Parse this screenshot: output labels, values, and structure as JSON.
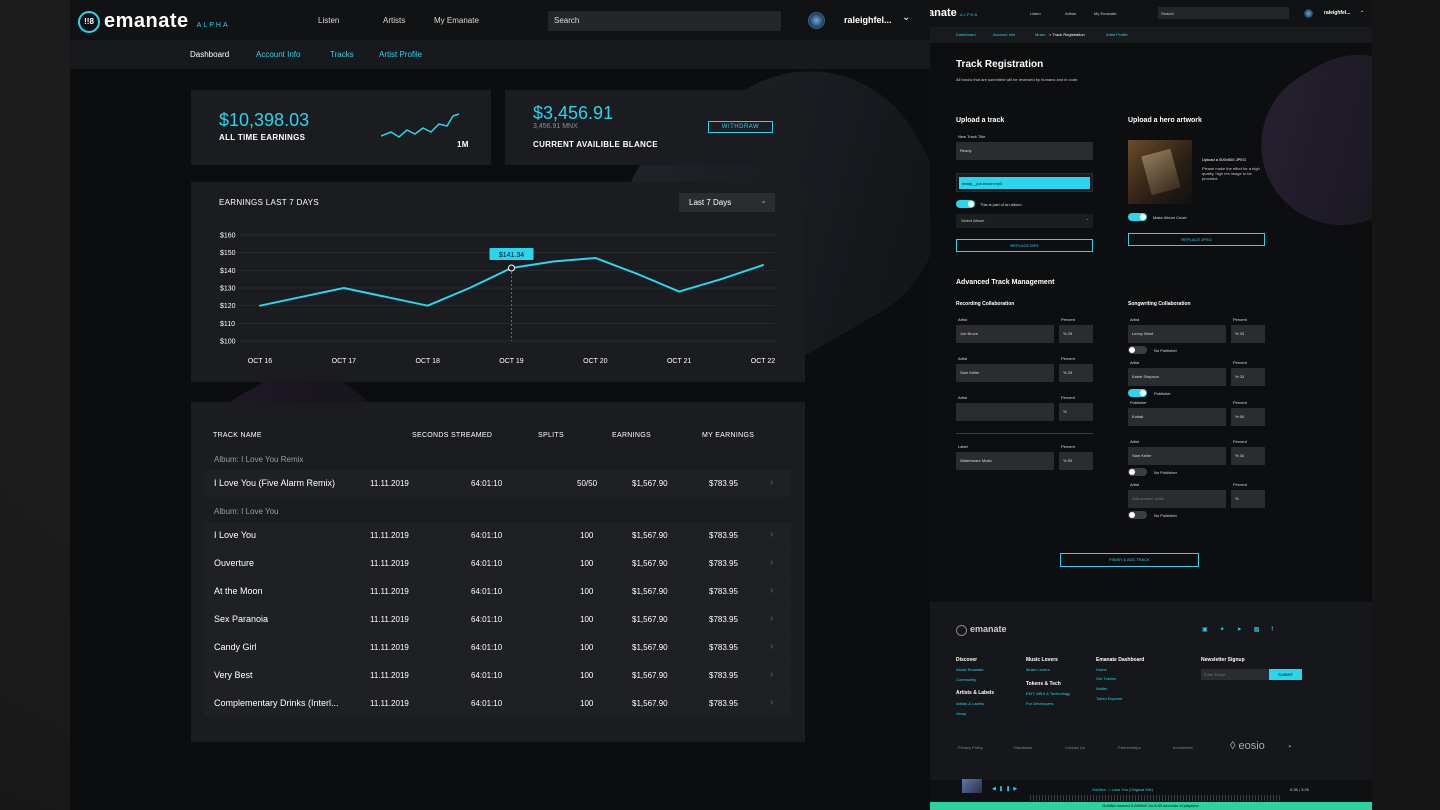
{
  "colors": {
    "accent": "#29d5ef",
    "background": "#0c0d0f",
    "card": "#1b1c1f",
    "row": "#1f2024",
    "notice_bar": "#2bd49e"
  },
  "brand": {
    "badge": "!!8",
    "name": "emanate",
    "tag": "ALPHA"
  },
  "nav": [
    "Listen",
    "Artists",
    "My Emanate"
  ],
  "search": {
    "value": "Search"
  },
  "user": {
    "name": "raleighfel..."
  },
  "subnav": [
    "Dashboard",
    "Account Info",
    "Tracks",
    "Artist Profile"
  ],
  "earnings": {
    "all_time": "$10,398.03",
    "all_time_label": "ALL TIME EARNINGS",
    "period": "1M",
    "balance": "$3,456.91",
    "balance_mnx": "3,456.91 MNX",
    "balance_label": "CURRENT AVAILIBLE BLANCE",
    "withdraw": "WITHDRAW"
  },
  "chart_data": {
    "type": "line",
    "title": "EARNINGS LAST 7 DAYS",
    "range_select": "Last 7 Days",
    "categories": [
      "OCT 16",
      "OCT 17",
      "OCT 18",
      "OCT 19",
      "OCT 20",
      "OCT 21",
      "OCT 22"
    ],
    "x": [
      "OCT 16",
      "OCT 16",
      "OCT 17",
      "OCT 17",
      "OCT 18",
      "OCT 18",
      "OCT 19",
      "OCT 19",
      "OCT 20",
      "OCT 20",
      "OCT 21",
      "OCT 21",
      "OCT 22"
    ],
    "values": [
      120,
      125,
      130,
      125,
      120,
      130,
      141.34,
      145,
      147,
      138,
      128,
      135,
      143
    ],
    "ylim": [
      100,
      160
    ],
    "yticks": [
      "$100",
      "$110",
      "$120",
      "$130",
      "$140",
      "$150",
      "$160"
    ],
    "tooltip": {
      "label": "$141.34",
      "index": 6
    },
    "grid": true
  },
  "table": {
    "headers": [
      "TRACK NAME",
      "SECONDS STREAMED",
      "SPLITS",
      "EARNINGS",
      "MY EARNINGS"
    ],
    "albums": [
      {
        "label": "Album:  I Love You Remix",
        "rows": [
          {
            "name": "I Love You (Five Alarm Remix)",
            "date": "11.11.2019",
            "streamed": "64:01:10",
            "splits": "50/50",
            "earnings": "$1,567.90",
            "my": "$783.95"
          }
        ]
      },
      {
        "label": "Album: I Love You",
        "rows": [
          {
            "name": "I Love You",
            "date": "11.11.2019",
            "streamed": "64:01:10",
            "splits": "100",
            "earnings": "$1,567.90",
            "my": "$783.95"
          },
          {
            "name": "Ouverture",
            "date": "11.11.2019",
            "streamed": "64:01:10",
            "splits": "100",
            "earnings": "$1,567.90",
            "my": "$783.95"
          },
          {
            "name": "At the Moon",
            "date": "11.11.2019",
            "streamed": "64:01:10",
            "splits": "100",
            "earnings": "$1,567.90",
            "my": "$783.95"
          },
          {
            "name": "Sex Paranoia",
            "date": "11.11.2019",
            "streamed": "64:01:10",
            "splits": "100",
            "earnings": "$1,567.90",
            "my": "$783.95"
          },
          {
            "name": "Candy Girl",
            "date": "11.11.2019",
            "streamed": "64:01:10",
            "splits": "100",
            "earnings": "$1,567.90",
            "my": "$783.95"
          },
          {
            "name": "Very Best",
            "date": "11.11.2019",
            "streamed": "64:01:10",
            "splits": "100",
            "earnings": "$1,567.90",
            "my": "$783.95"
          },
          {
            "name": "Complementary Drinks (Interl...",
            "date": "11.11.2019",
            "streamed": "64:01:10",
            "splits": "100",
            "earnings": "$1,567.90",
            "my": "$783.95"
          }
        ]
      }
    ]
  },
  "reg": {
    "brand": "anate",
    "tag": "ALPHA",
    "nav": [
      "Listen",
      "Artists",
      "My Emanate"
    ],
    "search": "Search",
    "user": "raleighfel...",
    "crumbs": [
      "Dashboard",
      "Account Info",
      "Music",
      "> Track Registration",
      "Artist Profile"
    ],
    "title": "Track Registration",
    "intro": "All tracks that are submitted will be reviewed by humans and in code.",
    "upload_track": "Upload a track",
    "new_title_label": "New Track Title",
    "new_title_value": "Ready",
    "file_name": "ready__joe-bruce.mp3",
    "album_toggle": "This is part of an album",
    "select_album": "Select Album",
    "replace_mp3": "REPLACE MP3",
    "upload_art": "Upload a hero artwork",
    "art_hint_title": "Upload a 500x500 JPEG",
    "art_hint": "Please make the effort for a high quality, high res image to be provided",
    "album_cover": "Make Album Cover",
    "replace_jpeg": "REPLACE JPEG",
    "advanced": "Advanced Track Management",
    "recording": "Recording Collaboration",
    "songwriting": "Songwriting Collaboration",
    "artist_label": "Artist",
    "percent_label": "Percent",
    "label_label": "Label",
    "publisher_label": "Publisher",
    "no_publisher": "No Publisher",
    "rec_rows": [
      {
        "artist": "Joe Bruce",
        "pct": "% 25"
      },
      {
        "artist": "Sam Keller",
        "pct": "% 25"
      },
      {
        "artist": "",
        "pct": "%"
      }
    ],
    "label_row": {
      "name": "Waterbeare Music",
      "pct": "% 50"
    },
    "song_rows": [
      {
        "artist": "Lenny West",
        "pct": "% 33"
      },
      {
        "artist": "Kanie Simpson",
        "pct": "% 33"
      },
      {
        "artist": "Kobalt",
        "pct": "% 50"
      },
      {
        "artist": "Sam Keller",
        "pct": "% 34"
      },
      {
        "artist": "Add another artist",
        "pct": "%"
      }
    ],
    "finish": "FINISH & ADD TRACK",
    "footer": {
      "brand": "emanate",
      "discover": "Discover",
      "discover_links": [
        "About Emanate",
        "Community"
      ],
      "artists_labels": "Artists & Labels",
      "artists_links": [
        "Artists & Labels",
        "Vamp"
      ],
      "music_lovers": "Music Lovers",
      "music_links": [
        "Music Lovers"
      ],
      "tokens": "Tokens & Tech",
      "tokens_links": [
        "EMT, MNX & Technology",
        "For Developers"
      ],
      "dashboard": "Emanate Dashboard",
      "dashboard_links": [
        "Home",
        "Get Tokens",
        "Wallet",
        "Token Explorer"
      ],
      "newsletter": "Newsletter Signup",
      "email_placeholder": "Enter Email",
      "submit": "SUBMIT",
      "legal": [
        "Privacy Policy",
        "Disclaimer",
        "Contact Us",
        "Partnerships",
        "Investment"
      ],
      "eosio": "eosio"
    },
    "player": {
      "now": "Goldfox - I Love You (Original Mix)",
      "time": "0:35 / 3:29"
    },
    "notice": "Goldfox earned 0.26MNX for 6.33 seconds of playtime."
  }
}
